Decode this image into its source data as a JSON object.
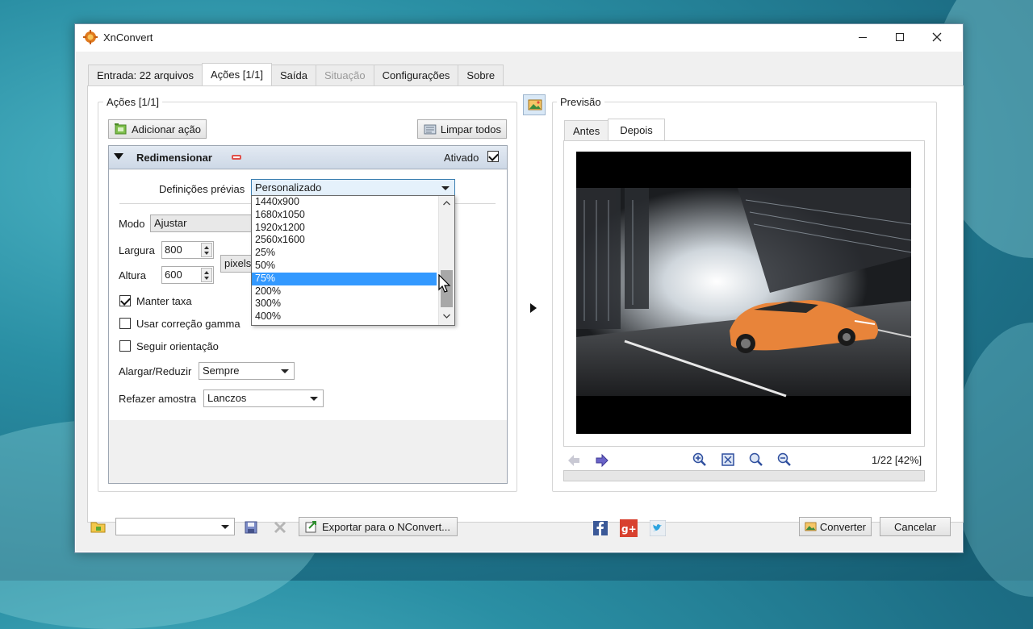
{
  "window": {
    "title": "XnConvert"
  },
  "tabs": [
    {
      "label": "Entrada: 22 arquivos",
      "active": false,
      "disabled": false
    },
    {
      "label": "Ações [1/1]",
      "active": true,
      "disabled": false
    },
    {
      "label": "Saída",
      "active": false,
      "disabled": false
    },
    {
      "label": "Situação",
      "active": false,
      "disabled": true
    },
    {
      "label": "Configurações",
      "active": false,
      "disabled": false
    },
    {
      "label": "Sobre",
      "active": false,
      "disabled": false
    }
  ],
  "actions": {
    "group_label": "Ações [1/1]",
    "add_label": "Adicionar ação",
    "clear_label": "Limpar todos",
    "resize": {
      "title": "Redimensionar",
      "enabled_label": "Ativado",
      "enabled": true,
      "presets_label": "Definições prévias",
      "presets_value": "Personalizado",
      "mode_label": "Modo",
      "mode_value": "Ajustar",
      "width_label": "Largura",
      "width_value": "800",
      "height_label": "Altura",
      "height_value": "600",
      "unit_value": "pixels",
      "keep_ratio_label": "Manter taxa",
      "keep_ratio": true,
      "gamma_label": "Usar correção gamma",
      "gamma": false,
      "orientation_label": "Seguir orientação",
      "orientation": false,
      "enlarge_label": "Alargar/Reduzir",
      "enlarge_value": "Sempre",
      "resample_label": "Refazer amostra",
      "resample_value": "Lanczos"
    },
    "preset_options": [
      "1440x900",
      "1680x1050",
      "1920x1200",
      "2560x1600",
      "25%",
      "50%",
      "75%",
      "200%",
      "300%",
      "400%"
    ],
    "preset_selected": "75%"
  },
  "preview": {
    "group_label": "Previsão",
    "tabs": [
      {
        "label": "Antes",
        "active": false
      },
      {
        "label": "Depois",
        "active": true
      }
    ],
    "status": "1/22 [42%]"
  },
  "bottom": {
    "export_label": "Exportar para o NConvert...",
    "convert_label": "Converter",
    "cancel_label": "Cancelar"
  },
  "colors": {
    "selection": "#3399ff",
    "car": "#e8843a"
  }
}
